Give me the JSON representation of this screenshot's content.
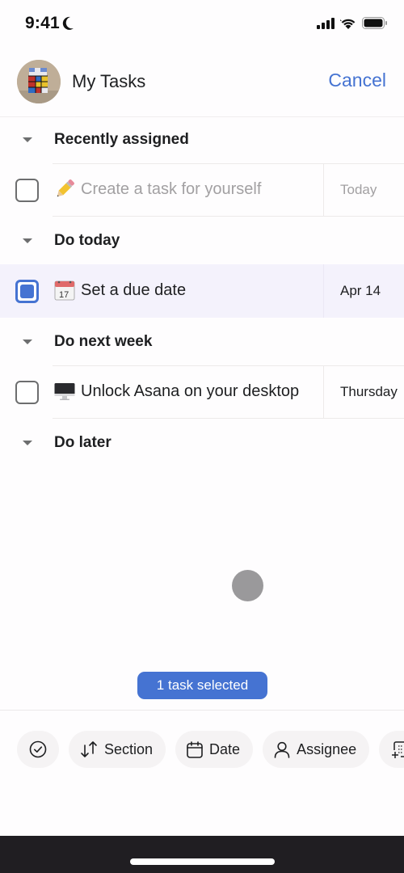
{
  "status_bar": {
    "time": "9:41",
    "icons": [
      "moon-icon",
      "cellular-signal-icon",
      "wifi-icon",
      "battery-icon"
    ]
  },
  "header": {
    "title": "My Tasks",
    "cancel_label": "Cancel",
    "avatar_icon": "avatar-rubiks-cube"
  },
  "sections": [
    {
      "title": "Recently assigned",
      "tasks": [
        {
          "emoji_icon": "pencil-icon",
          "name": "Create a task for yourself",
          "date": "Today",
          "placeholder": true,
          "selected": false
        }
      ]
    },
    {
      "title": "Do today",
      "tasks": [
        {
          "emoji_icon": "calendar-icon",
          "name": "Set a due date",
          "date": "Apr 14",
          "placeholder": false,
          "selected": true
        }
      ]
    },
    {
      "title": "Do next week",
      "tasks": [
        {
          "emoji_icon": "desktop-computer-icon",
          "name": "Unlock Asana on your desktop",
          "date": "Thursday",
          "placeholder": false,
          "selected": false
        }
      ]
    },
    {
      "title": "Do later",
      "tasks": []
    }
  ],
  "selection": {
    "label": "1 task selected"
  },
  "toolbar": {
    "complete_icon": "check-circle-icon",
    "section_label": "Section",
    "date_label": "Date",
    "assignee_label": "Assignee",
    "more_icon": "add-project-icon"
  },
  "colors": {
    "accent": "#4573d2",
    "selected_row": "#f4f2fc",
    "text": "#1e1f21",
    "placeholder": "#a2a0a2"
  }
}
